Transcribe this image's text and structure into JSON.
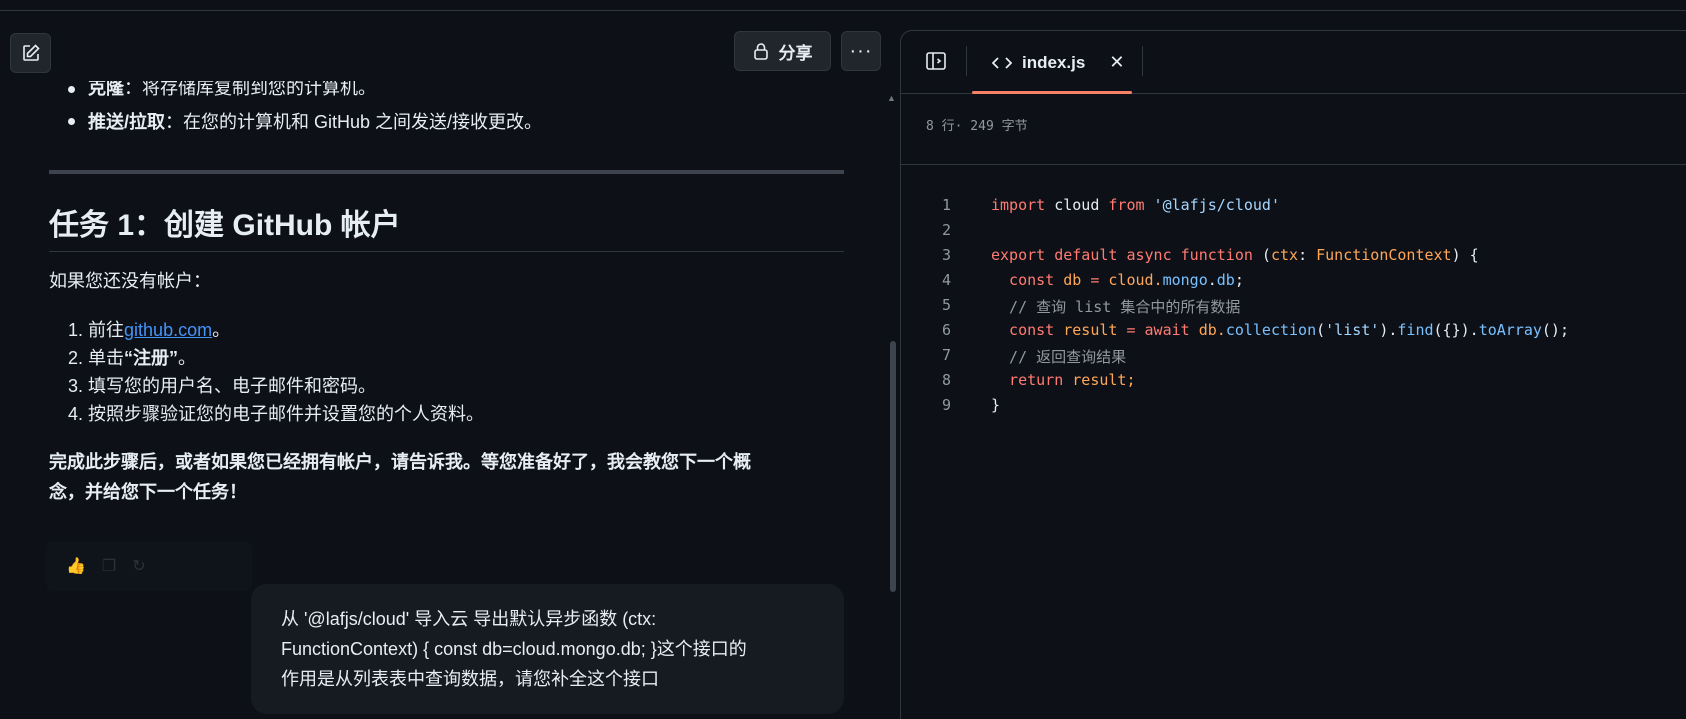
{
  "chat": {
    "header": {
      "share_label": "分享",
      "more_label": "···"
    },
    "clipped_item": {
      "bold": "克隆",
      "text": "：将存储库复制到您的计算机。"
    },
    "bullet2": {
      "bold": "推送/拉取",
      "text": "：在您的计算机和 GitHub 之间发送/接收更改。"
    },
    "heading": "任务 1：创建 GitHub 帐户",
    "intro": "如果您还没有帐户：",
    "steps": [
      {
        "num": "1.",
        "pre": "前往",
        "link": "github.com",
        "post": "。"
      },
      {
        "num": "2.",
        "pre": "单击",
        "bold": "“注册”",
        "post": "。"
      },
      {
        "num": "3.",
        "text": "填写您的用户名、电子邮件和密码。"
      },
      {
        "num": "4.",
        "text": "按照步骤验证您的电子邮件并设置您的个人资料。"
      }
    ],
    "closing_line1": "完成此步骤后，或者如果您已经拥有帐户，请告诉我。等您准备好了，我会教您下一个概",
    "closing_line2": "念，并给您下一个任务！",
    "user_message_line1": "从 '@lafjs/cloud' 导入云 导出默认异步函数 (ctx:",
    "user_message_line2": "FunctionContext) { const db=cloud.mongo.db; }这个接口的",
    "user_message_line3": "作用是从列表表中查询数据，请您补全这个接口"
  },
  "code_panel": {
    "tab_name": "index.js",
    "meta": "8 行· 249 字节",
    "lines": [
      "1",
      "2",
      "3",
      "4",
      "5",
      "6",
      "7",
      "8",
      "9"
    ],
    "code": {
      "l1a": "import",
      "l1b": " cloud ",
      "l1c": "from",
      "l1d": " '@lafjs/cloud'",
      "l3a": "export default async function",
      "l3b": " (",
      "l3c": "ctx",
      "l3d": ": ",
      "l3e": "FunctionContext",
      "l3f": ") {",
      "l4a": "  const",
      "l4b": " db ",
      "l4c": "=",
      "l4d": " cloud.",
      "l4e": "mongo",
      "l4f": ".",
      "l4g": "db",
      "l4h": ";",
      "l5": "  // 查询 list 集合中的所有数据",
      "l6a": "  const",
      "l6b": " result ",
      "l6c": "=",
      "l6d": " await",
      "l6e": " db.",
      "l6f": "collection",
      "l6g": "(",
      "l6h": "'list'",
      "l6i": ").",
      "l6j": "find",
      "l6k": "({}).",
      "l6l": "toArray",
      "l6m": "();",
      "l7": "  // 返回查询结果",
      "l8a": "  return",
      "l8b": " result;",
      "l9": "}"
    }
  }
}
